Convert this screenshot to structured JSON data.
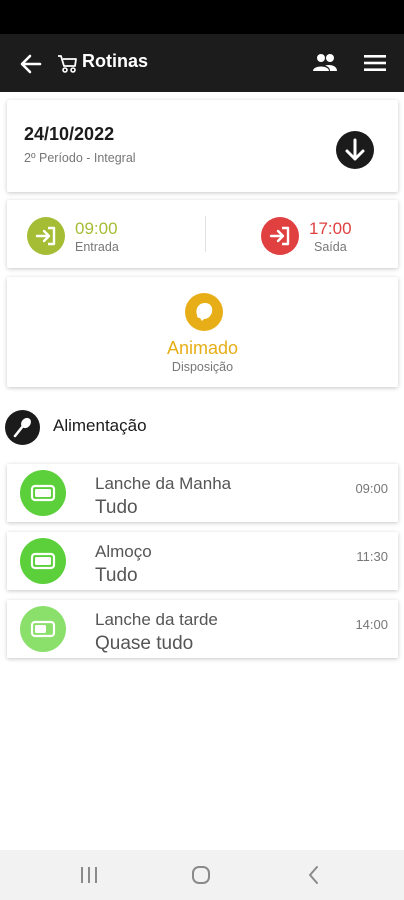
{
  "app_bar": {
    "title": "Rotinas"
  },
  "routine": {
    "date": "24/10/2022",
    "period": "2º Período - Integral"
  },
  "times": {
    "entry": {
      "time": "09:00",
      "label": "Entrada",
      "color": "#a5bd35"
    },
    "exit": {
      "time": "17:00",
      "label": "Saída",
      "color": "#e04040"
    }
  },
  "mood": {
    "value": "Animado",
    "label": "Disposição",
    "color": "#e7ae17"
  },
  "feeding": {
    "title": "Alimentação",
    "meals": [
      {
        "name": "Lanche da Manha",
        "amount": "Tudo",
        "time": "09:00",
        "color": "#5cd03a"
      },
      {
        "name": "Almoço",
        "amount": "Tudo",
        "time": "11:30",
        "color": "#5cd03a"
      },
      {
        "name": "Lanche da tarde",
        "amount": "Quase tudo",
        "time": "14:00",
        "color": "#8ae06a"
      }
    ]
  },
  "icons": [
    "back-arrow-icon",
    "stroller-icon",
    "people-icon",
    "menu-icon",
    "download-icon",
    "login-icon",
    "logout-icon",
    "face-icon",
    "spoon-icon",
    "battery-icon",
    "recents-icon",
    "home-icon",
    "back-icon"
  ]
}
